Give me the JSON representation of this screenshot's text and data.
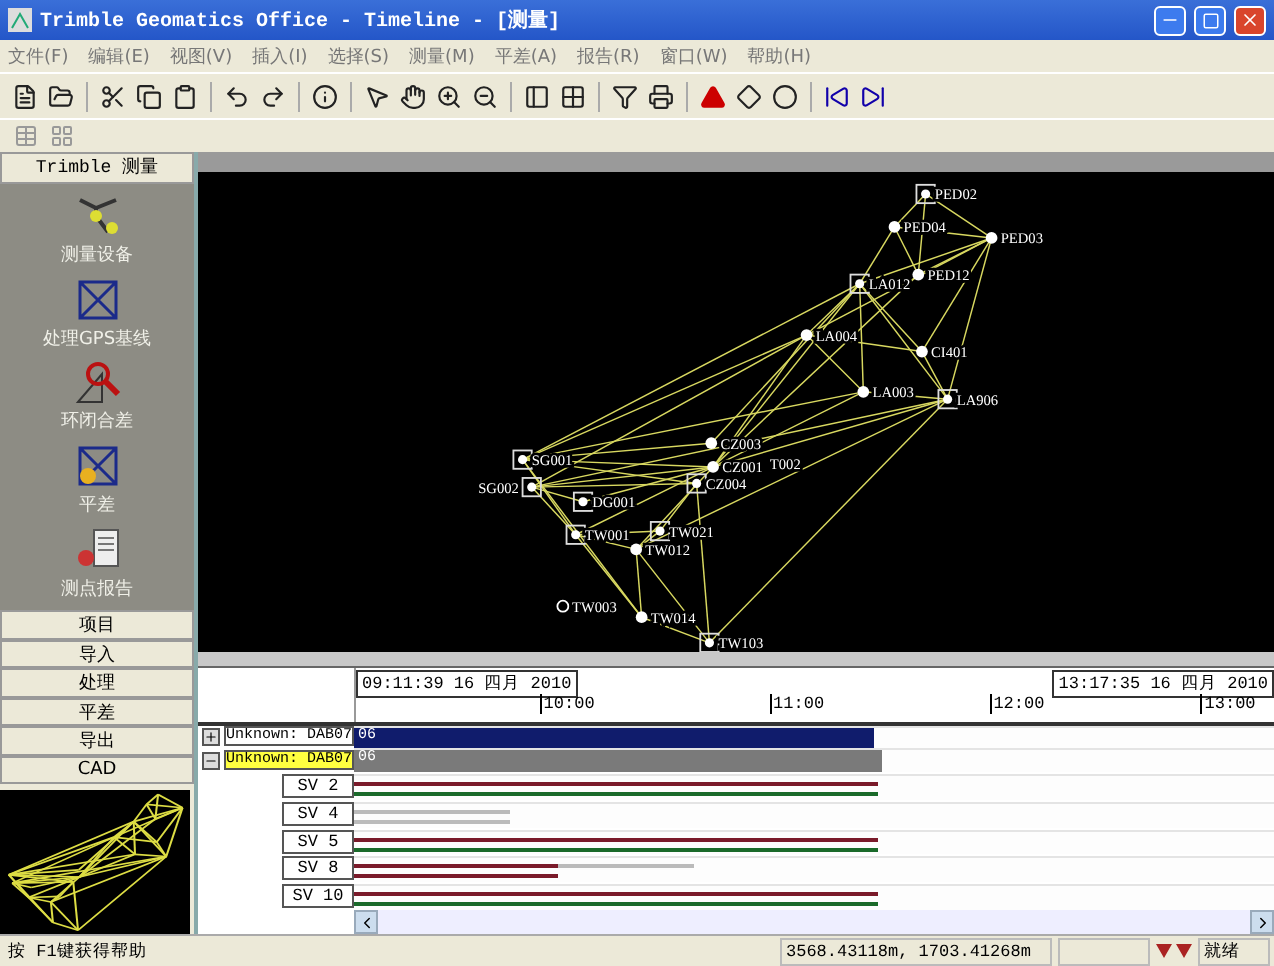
{
  "window": {
    "title": "Trimble Geomatics Office - Timeline - [测量]"
  },
  "menu": [
    "文件(F)",
    "编辑(E)",
    "视图(V)",
    "插入(I)",
    "选择(S)",
    "测量(M)",
    "平差(A)",
    "报告(R)",
    "窗口(W)",
    "帮助(H)"
  ],
  "sidebar": {
    "header": "Trimble 测量",
    "tools": [
      {
        "label": "测量设备",
        "kind": "equipment"
      },
      {
        "label": "处理GPS基线",
        "kind": "baseline"
      },
      {
        "label": "环闭合差",
        "kind": "loop"
      },
      {
        "label": "平差",
        "kind": "adjust"
      },
      {
        "label": "测点报告",
        "kind": "report"
      }
    ],
    "groups": [
      "项目",
      "导入",
      "处理",
      "平差",
      "导出",
      "CAD"
    ]
  },
  "network": {
    "points": [
      {
        "label": "PED02",
        "kind": "fixed"
      },
      {
        "label": "PED04",
        "kind": "point"
      },
      {
        "label": "PED03",
        "kind": "point"
      },
      {
        "label": "LA012",
        "kind": "fixed"
      },
      {
        "label": "PED12",
        "kind": "point"
      },
      {
        "label": "LA004",
        "kind": "point"
      },
      {
        "label": "CI401",
        "kind": "point"
      },
      {
        "label": "LA003",
        "kind": "point"
      },
      {
        "label": "LA906",
        "kind": "fixed"
      },
      {
        "label": "CZ003",
        "kind": "point"
      },
      {
        "label": "SG001",
        "kind": "fixed"
      },
      {
        "label": "CZ001",
        "kind": "point"
      },
      {
        "label": "T002",
        "kind": "label"
      },
      {
        "label": "CZ004",
        "kind": "fixed"
      },
      {
        "label": "SG002",
        "kind": "fixed"
      },
      {
        "label": "DG001",
        "kind": "fixed"
      },
      {
        "label": "TW001",
        "kind": "fixed"
      },
      {
        "label": "TW021",
        "kind": "fixed"
      },
      {
        "label": "TW012",
        "kind": "point"
      },
      {
        "label": "TW003",
        "kind": "hollow"
      },
      {
        "label": "TW014",
        "kind": "point"
      },
      {
        "label": "TW103",
        "kind": "fixed"
      }
    ]
  },
  "timeline": {
    "start": "09:11:39 16 四月 2010",
    "end": "13:17:35 16 四月 2010",
    "ticks": [
      "10:00",
      "11:00",
      "12:00",
      "13:00"
    ],
    "receivers": [
      {
        "label": "Unknown: DAB07",
        "expanded": false,
        "selected": false,
        "bar": "06",
        "level": 0.56
      },
      {
        "label": "Unknown: DAB07",
        "expanded": true,
        "selected": true,
        "bar": "06",
        "level": 0.57
      }
    ],
    "satellites": [
      {
        "label": "SV 2",
        "kind": "tracked",
        "level": 0.57
      },
      {
        "label": "SV 4",
        "kind": "partial",
        "level": 0.17
      },
      {
        "label": "SV 5",
        "kind": "tracked",
        "level": 0.57
      },
      {
        "label": "SV 8",
        "kind": "mixed",
        "level": 0.37
      },
      {
        "label": "SV 10",
        "kind": "tracked",
        "level": 0.57
      }
    ]
  },
  "status_bar": {
    "hint": "按 F1键获得帮助",
    "coordinates": "3568.43118m, 1703.41268m",
    "state": "就绪"
  }
}
